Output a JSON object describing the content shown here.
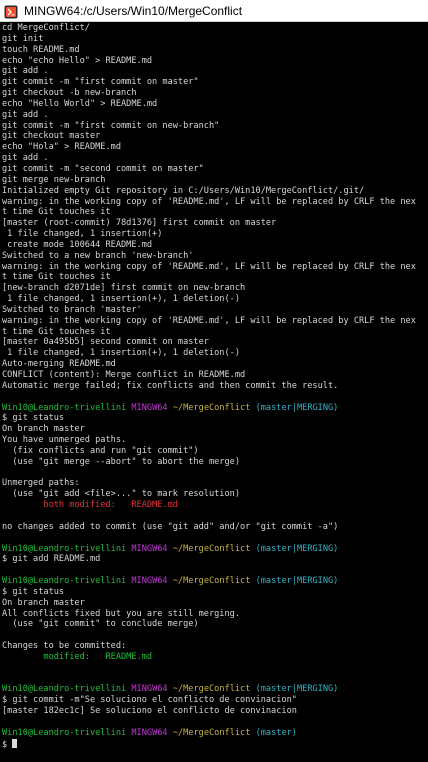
{
  "window": {
    "title": "MINGW64:/c/Users/Win10/MergeConflict"
  },
  "colors": {
    "user_host": "#1fbf3a",
    "shell": "#c23bd3",
    "path": "#c8b43a",
    "branch": "#2fb4c8",
    "unmerged": "#e0333a",
    "staged": "#1fbf3a"
  },
  "terminal": {
    "lines": [
      {
        "segs": [
          {
            "t": "cd MergeConflict/"
          }
        ]
      },
      {
        "segs": [
          {
            "t": "git init"
          }
        ]
      },
      {
        "segs": [
          {
            "t": "touch README.md"
          }
        ]
      },
      {
        "segs": [
          {
            "t": "echo \"echo Hello\" > README.md"
          }
        ]
      },
      {
        "segs": [
          {
            "t": "git add ."
          }
        ]
      },
      {
        "segs": [
          {
            "t": "git commit -m \"first commit on master\""
          }
        ]
      },
      {
        "segs": [
          {
            "t": "git checkout -b new-branch"
          }
        ]
      },
      {
        "segs": [
          {
            "t": "echo \"Hello World\" > README.md"
          }
        ]
      },
      {
        "segs": [
          {
            "t": "git add ."
          }
        ]
      },
      {
        "segs": [
          {
            "t": "git commit -m \"first commit on new-branch\""
          }
        ]
      },
      {
        "segs": [
          {
            "t": "git checkout master"
          }
        ]
      },
      {
        "segs": [
          {
            "t": "echo \"Hola\" > README.md"
          }
        ]
      },
      {
        "segs": [
          {
            "t": "git add ."
          }
        ]
      },
      {
        "segs": [
          {
            "t": "git commit -m \"second commit on master\""
          }
        ]
      },
      {
        "segs": [
          {
            "t": "git merge new-branch"
          }
        ]
      },
      {
        "segs": [
          {
            "t": "Initialized empty Git repository in C:/Users/Win10/MergeConflict/.git/"
          }
        ]
      },
      {
        "segs": [
          {
            "t": "warning: in the working copy of 'README.md', LF will be replaced by CRLF the nex"
          }
        ]
      },
      {
        "segs": [
          {
            "t": "t time Git touches it"
          }
        ]
      },
      {
        "segs": [
          {
            "t": "[master (root-commit) 78d1376] first commit on master"
          }
        ]
      },
      {
        "segs": [
          {
            "t": " 1 file changed, 1 insertion(+)"
          }
        ]
      },
      {
        "segs": [
          {
            "t": " create mode 100644 README.md"
          }
        ]
      },
      {
        "segs": [
          {
            "t": "Switched to a new branch 'new-branch'"
          }
        ]
      },
      {
        "segs": [
          {
            "t": "warning: in the working copy of 'README.md', LF will be replaced by CRLF the nex"
          }
        ]
      },
      {
        "segs": [
          {
            "t": "t time Git touches it"
          }
        ]
      },
      {
        "segs": [
          {
            "t": "[new-branch d2071de] first commit on new-branch"
          }
        ]
      },
      {
        "segs": [
          {
            "t": " 1 file changed, 1 insertion(+), 1 deletion(-)"
          }
        ]
      },
      {
        "segs": [
          {
            "t": "Switched to branch 'master'"
          }
        ]
      },
      {
        "segs": [
          {
            "t": "warning: in the working copy of 'README.md', LF will be replaced by CRLF the nex"
          }
        ]
      },
      {
        "segs": [
          {
            "t": "t time Git touches it"
          }
        ]
      },
      {
        "segs": [
          {
            "t": "[master 0a495b5] second commit on master"
          }
        ]
      },
      {
        "segs": [
          {
            "t": " 1 file changed, 1 insertion(+), 1 deletion(-)"
          }
        ]
      },
      {
        "segs": [
          {
            "t": "Auto-merging README.md"
          }
        ]
      },
      {
        "segs": [
          {
            "t": "CONFLICT (content): Merge conflict in README.md"
          }
        ]
      },
      {
        "segs": [
          {
            "t": "Automatic merge failed; fix conflicts and then commit the result."
          }
        ]
      },
      {
        "segs": [
          {
            "t": ""
          }
        ]
      },
      {
        "segs": [
          {
            "t": "Win10@Leandro-trivellini",
            "c": "u"
          },
          {
            "t": " "
          },
          {
            "t": "MINGW64",
            "c": "h"
          },
          {
            "t": " "
          },
          {
            "t": "~/MergeConflict",
            "c": "p"
          },
          {
            "t": " "
          },
          {
            "t": "(master|MERGING)",
            "c": "b"
          }
        ]
      },
      {
        "segs": [
          {
            "t": "$ git status"
          }
        ]
      },
      {
        "segs": [
          {
            "t": "On branch master"
          }
        ]
      },
      {
        "segs": [
          {
            "t": "You have unmerged paths."
          }
        ]
      },
      {
        "segs": [
          {
            "t": "  (fix conflicts and run \"git commit\")"
          }
        ]
      },
      {
        "segs": [
          {
            "t": "  (use \"git merge --abort\" to abort the merge)"
          }
        ]
      },
      {
        "segs": [
          {
            "t": ""
          }
        ]
      },
      {
        "segs": [
          {
            "t": "Unmerged paths:"
          }
        ]
      },
      {
        "segs": [
          {
            "t": "  (use \"git add <file>...\" to mark resolution)"
          }
        ]
      },
      {
        "segs": [
          {
            "t": "        both modified:   README.md",
            "c": "r"
          }
        ]
      },
      {
        "segs": [
          {
            "t": ""
          }
        ]
      },
      {
        "segs": [
          {
            "t": "no changes added to commit (use \"git add\" and/or \"git commit -a\")"
          }
        ]
      },
      {
        "segs": [
          {
            "t": ""
          }
        ]
      },
      {
        "segs": [
          {
            "t": "Win10@Leandro-trivellini",
            "c": "u"
          },
          {
            "t": " "
          },
          {
            "t": "MINGW64",
            "c": "h"
          },
          {
            "t": " "
          },
          {
            "t": "~/MergeConflict",
            "c": "p"
          },
          {
            "t": " "
          },
          {
            "t": "(master|MERGING)",
            "c": "b"
          }
        ]
      },
      {
        "segs": [
          {
            "t": "$ git add README.md"
          }
        ]
      },
      {
        "segs": [
          {
            "t": ""
          }
        ]
      },
      {
        "segs": [
          {
            "t": "Win10@Leandro-trivellini",
            "c": "u"
          },
          {
            "t": " "
          },
          {
            "t": "MINGW64",
            "c": "h"
          },
          {
            "t": " "
          },
          {
            "t": "~/MergeConflict",
            "c": "p"
          },
          {
            "t": " "
          },
          {
            "t": "(master|MERGING)",
            "c": "b"
          }
        ]
      },
      {
        "segs": [
          {
            "t": "$ git status"
          }
        ]
      },
      {
        "segs": [
          {
            "t": "On branch master"
          }
        ]
      },
      {
        "segs": [
          {
            "t": "All conflicts fixed but you are still merging."
          }
        ]
      },
      {
        "segs": [
          {
            "t": "  (use \"git commit\" to conclude merge)"
          }
        ]
      },
      {
        "segs": [
          {
            "t": ""
          }
        ]
      },
      {
        "segs": [
          {
            "t": "Changes to be committed:"
          }
        ]
      },
      {
        "segs": [
          {
            "t": "        modified:   README.md",
            "c": "g"
          }
        ]
      },
      {
        "segs": [
          {
            "t": ""
          }
        ]
      },
      {
        "segs": [
          {
            "t": ""
          }
        ]
      },
      {
        "segs": [
          {
            "t": "Win10@Leandro-trivellini",
            "c": "u"
          },
          {
            "t": " "
          },
          {
            "t": "MINGW64",
            "c": "h"
          },
          {
            "t": " "
          },
          {
            "t": "~/MergeConflict",
            "c": "p"
          },
          {
            "t": " "
          },
          {
            "t": "(master|MERGING)",
            "c": "b"
          }
        ]
      },
      {
        "segs": [
          {
            "t": "$ git commit -m\"Se soluciono el conflicto de convinacion\""
          }
        ]
      },
      {
        "segs": [
          {
            "t": "[master 182ec1c] Se soluciono el conflicto de convinacion"
          }
        ]
      },
      {
        "segs": [
          {
            "t": ""
          }
        ]
      },
      {
        "segs": [
          {
            "t": "Win10@Leandro-trivellini",
            "c": "u"
          },
          {
            "t": " "
          },
          {
            "t": "MINGW64",
            "c": "h"
          },
          {
            "t": " "
          },
          {
            "t": "~/MergeConflict",
            "c": "p"
          },
          {
            "t": " "
          },
          {
            "t": "(master)",
            "c": "b"
          }
        ]
      },
      {
        "segs": [
          {
            "t": "$ "
          }
        ],
        "cursor": true
      }
    ]
  }
}
